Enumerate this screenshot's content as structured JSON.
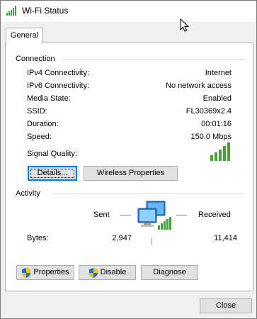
{
  "window": {
    "title": "Wi-Fi Status",
    "close_glyph": "✕"
  },
  "tabs": [
    {
      "label": "General"
    }
  ],
  "connection": {
    "header": "Connection",
    "rows": [
      {
        "label": "IPv4 Connectivity:",
        "value": "Internet"
      },
      {
        "label": "IPv6 Connectivity:",
        "value": "No network access"
      },
      {
        "label": "Media State:",
        "value": "Enabled"
      },
      {
        "label": "SSID:",
        "value": "FL30369x2.4"
      },
      {
        "label": "Duration:",
        "value": "00:01:16"
      },
      {
        "label": "Speed:",
        "value": "150.0 Mbps"
      }
    ],
    "signal_label": "Signal Quality:",
    "signal_bars": 5,
    "signal_bars_filled": 5,
    "details_button": "Details...",
    "wireless_button": "Wireless Properties"
  },
  "activity": {
    "header": "Activity",
    "sent_label": "Sent",
    "received_label": "Received",
    "bytes_label": "Bytes:",
    "bytes_sent": "2,947",
    "bytes_received": "11,414"
  },
  "actions": {
    "properties": "Properties",
    "disable": "Disable",
    "diagnose": "Diagnose"
  },
  "footer": {
    "close_button": "Close"
  },
  "colors": {
    "signal_green": "#3fa534",
    "focus_blue": "#0078d7",
    "button_face": "#e1e1e1",
    "window_bg": "#f0f0f0"
  },
  "icons": {
    "title": "wifi-signal-icon",
    "network": "network-computers-icon",
    "shield": "uac-shield-icon",
    "cursor": "mouse-pointer-icon"
  }
}
